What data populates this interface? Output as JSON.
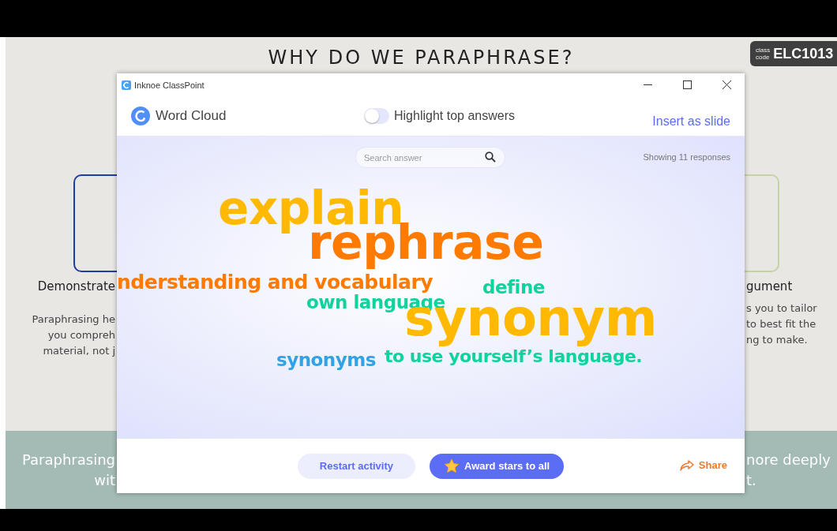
{
  "slide": {
    "title": "WHY DO WE PARAPHRASE?",
    "class_code": {
      "label_top": "class",
      "label_bottom": "code",
      "code": "ELC1013"
    },
    "left_column": {
      "heading": "Demonstrate",
      "lines": [
        "Paraphrasing he",
        "you compreh",
        "material, not j"
      ]
    },
    "right_column": {
      "heading": "gument",
      "lines": [
        "s you to tailor",
        "to best fit the",
        "ng to make."
      ]
    },
    "banner": {
      "left_lines": [
        "Paraphrasing",
        "wit"
      ],
      "right_lines": [
        "nore deeply",
        "t."
      ]
    }
  },
  "window": {
    "title": "Inknoe ClassPoint",
    "header": {
      "title": "Word Cloud",
      "toggle": {
        "label": "Highlight top answers",
        "on": false
      },
      "insert_link": "Insert as slide"
    },
    "search": {
      "placeholder": "Search answer"
    },
    "response_count": "Showing 11 responses",
    "words": [
      {
        "text": "explain",
        "color": "#ffb900"
      },
      {
        "text": "rephrase",
        "color": "#ff7a00"
      },
      {
        "text": "nderstanding and vocabulary",
        "color": "#ff7a00"
      },
      {
        "text": "define",
        "color": "#0dd39c"
      },
      {
        "text": "own language",
        "color": "#0dd39c"
      },
      {
        "text": "synonym",
        "color": "#ffb900"
      },
      {
        "text": "synonyms",
        "color": "#2fa3e6"
      },
      {
        "text": "to use yourself’s language.",
        "color": "#0dd39c"
      }
    ],
    "footer": {
      "restart": "Restart activity",
      "award": "Award stars to all",
      "share": "Share"
    }
  }
}
